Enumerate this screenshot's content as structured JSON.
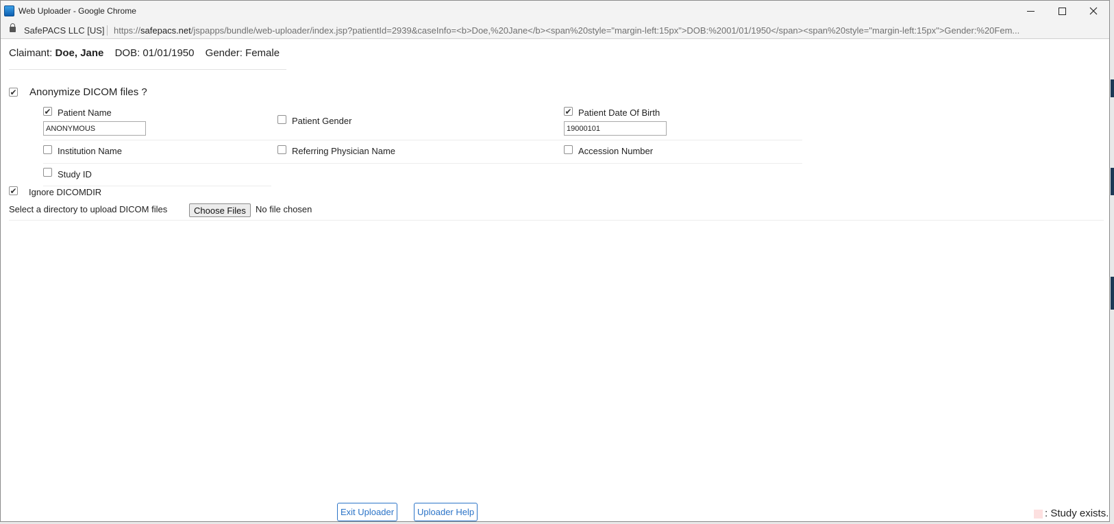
{
  "window": {
    "title": "Web Uploader - Google Chrome",
    "app_icon": "chrome-app-icon",
    "controls": {
      "minimize": "minimize-icon",
      "maximize": "maximize-icon",
      "close": "close-icon"
    }
  },
  "addressbar": {
    "cert_label": "SafePACS LLC [US]",
    "url_scheme": "https://",
    "url_host": "safepacs.net",
    "url_rest": "/jspapps/bundle/web-uploader/index.jsp?patientId=2939&caseInfo=<b>Doe,%20Jane</b><span%20style=\"margin-left:15px\">DOB:%2001/01/1950</span><span%20style=\"margin-left:15px\">Gender:%20Fem..."
  },
  "claimant": {
    "label": "Claimant:",
    "name": "Doe, Jane",
    "dob": "DOB: 01/01/1950",
    "gender": "Gender: Female"
  },
  "anonymize": {
    "label": "Anonymize DICOM files ?",
    "checked": true,
    "fields": {
      "patient_name": {
        "label": "Patient Name",
        "checked": true,
        "value": "ANONYMOUS"
      },
      "patient_gender": {
        "label": "Patient Gender",
        "checked": false
      },
      "patient_dob": {
        "label": "Patient Date Of Birth",
        "checked": true,
        "value": "19000101"
      },
      "institution_name": {
        "label": "Institution Name",
        "checked": false
      },
      "referring_physician": {
        "label": "Referring Physician Name",
        "checked": false
      },
      "accession_number": {
        "label": "Accession Number",
        "checked": false
      },
      "study_id": {
        "label": "Study ID",
        "checked": false
      }
    }
  },
  "ignore_dicomdir": {
    "label": "Ignore DICOMDIR",
    "checked": true
  },
  "upload": {
    "label": "Select a directory to upload DICOM files",
    "button": "Choose Files",
    "status": "No file chosen"
  },
  "footer": {
    "exit_button": "Exit Uploader",
    "help_button": "Uploader Help",
    "legend_text": ": Study exists.",
    "legend_color": "#fde0e0"
  },
  "colors": {
    "link_blue": "#2a73c7",
    "titlebar_bg": "#f3f3f3"
  }
}
